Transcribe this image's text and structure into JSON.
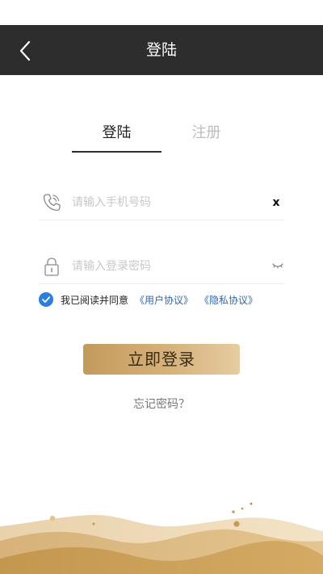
{
  "header": {
    "title": "登陆"
  },
  "tabs": [
    {
      "label": "登陆",
      "active": true
    },
    {
      "label": "注册",
      "active": false
    }
  ],
  "phone": {
    "placeholder": "请输入手机号码",
    "value": "",
    "clear_label": "x"
  },
  "password": {
    "placeholder": "请输入登录密码",
    "value": ""
  },
  "agreement": {
    "checked": true,
    "text": "我已阅读并同意",
    "user_link": "《用户协议》",
    "privacy_link": "《隐私协议》"
  },
  "login_button": "立即登录",
  "forgot": "忘记密码？",
  "colors": {
    "header_bg": "#2d2d2d",
    "accent_gold": "#c39a5c",
    "checkbox_blue": "#2b7ee0",
    "link_blue": "#2c66b8"
  }
}
